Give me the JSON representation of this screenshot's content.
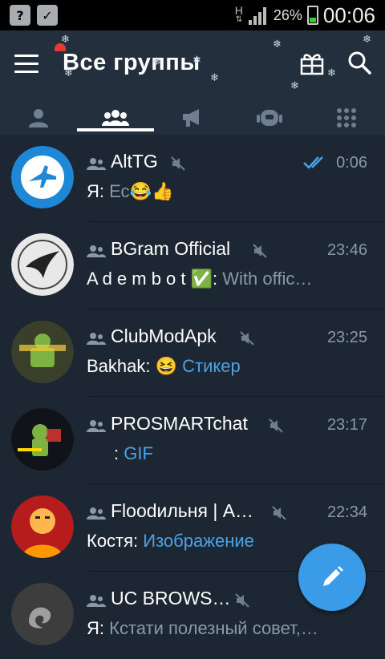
{
  "status_bar": {
    "network_type": "H",
    "battery_percent": "26%",
    "time": "00:06"
  },
  "app_bar": {
    "title": "Все группы"
  },
  "tabs": [
    {
      "icon": "person-icon",
      "selected": false
    },
    {
      "icon": "groups-icon",
      "selected": true
    },
    {
      "icon": "megaphone-icon",
      "selected": false
    },
    {
      "icon": "bot-icon",
      "selected": false
    },
    {
      "icon": "grid-icon",
      "selected": false
    }
  ],
  "chats": [
    {
      "name": "AltTG",
      "time": "0:06",
      "sender": "Я:",
      "preview": "Ес😂👍",
      "preview_is_media": false,
      "read": true,
      "muted": true
    },
    {
      "name": "BGram Official",
      "time": "23:46",
      "sender": "A d e m b o t ✅:",
      "preview": "With offic…",
      "preview_is_media": false,
      "read": false,
      "muted": true
    },
    {
      "name": "ClubModApk",
      "time": "23:25",
      "sender": "Bakhak:",
      "preview": "😆 Стикер",
      "preview_is_media": true,
      "read": false,
      "muted": true
    },
    {
      "name": "PROSMARTchat",
      "time": "23:17",
      "sender": ":",
      "preview": "GIF",
      "preview_is_media": true,
      "read": false,
      "muted": true
    },
    {
      "name": "Floodильня | A…",
      "time": "22:34",
      "sender": "Костя:",
      "preview": "Изображение",
      "preview_is_media": true,
      "read": false,
      "muted": true
    },
    {
      "name": "UC BROWS…",
      "time": "",
      "sender": "Я:",
      "preview": "Кстати полезный совет,…",
      "preview_is_media": false,
      "read": true,
      "muted": true
    }
  ],
  "colors": {
    "background": "#1d2733",
    "header": "#242f3d",
    "accent": "#3a9be8",
    "media_text": "#4aa3e8",
    "secondary_text": "#8a98a8"
  }
}
